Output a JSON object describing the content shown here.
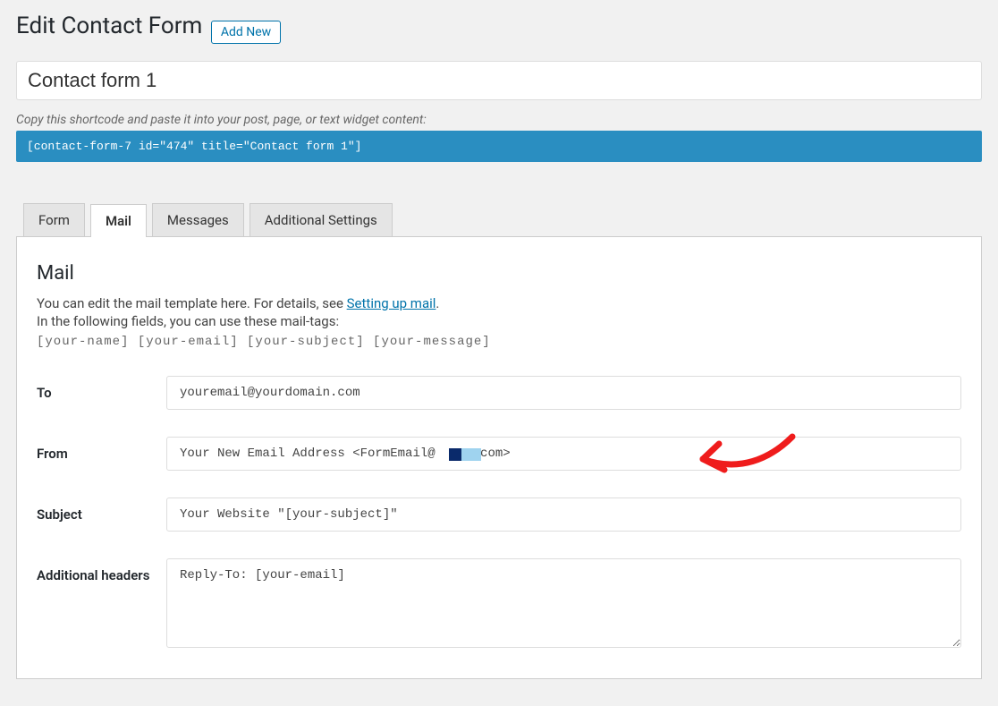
{
  "header": {
    "title": "Edit Contact Form",
    "add_new": "Add New"
  },
  "form_title": "Contact form 1",
  "shortcode_hint": "Copy this shortcode and paste it into your post, page, or text widget content:",
  "shortcode": "[contact-form-7 id=\"474\" title=\"Contact form 1\"]",
  "tabs": {
    "form": "Form",
    "mail": "Mail",
    "messages": "Messages",
    "additional": "Additional Settings"
  },
  "mail": {
    "heading": "Mail",
    "desc_prefix": "You can edit the mail template here. For details, see ",
    "desc_link": "Setting up mail",
    "desc_suffix": ".",
    "desc2": "In the following fields, you can use these mail-tags:",
    "tags": "[your-name] [your-email] [your-subject] [your-message]",
    "labels": {
      "to": "To",
      "from": "From",
      "subject": "Subject",
      "additional_headers": "Additional headers"
    },
    "fields": {
      "to": "youremail@yourdomain.com",
      "from": "Your New Email Address <FormEmail@▮▮▮.com>",
      "subject": "Your Website \"[your-subject]\"",
      "additional_headers": "Reply-To: [your-email]"
    }
  }
}
